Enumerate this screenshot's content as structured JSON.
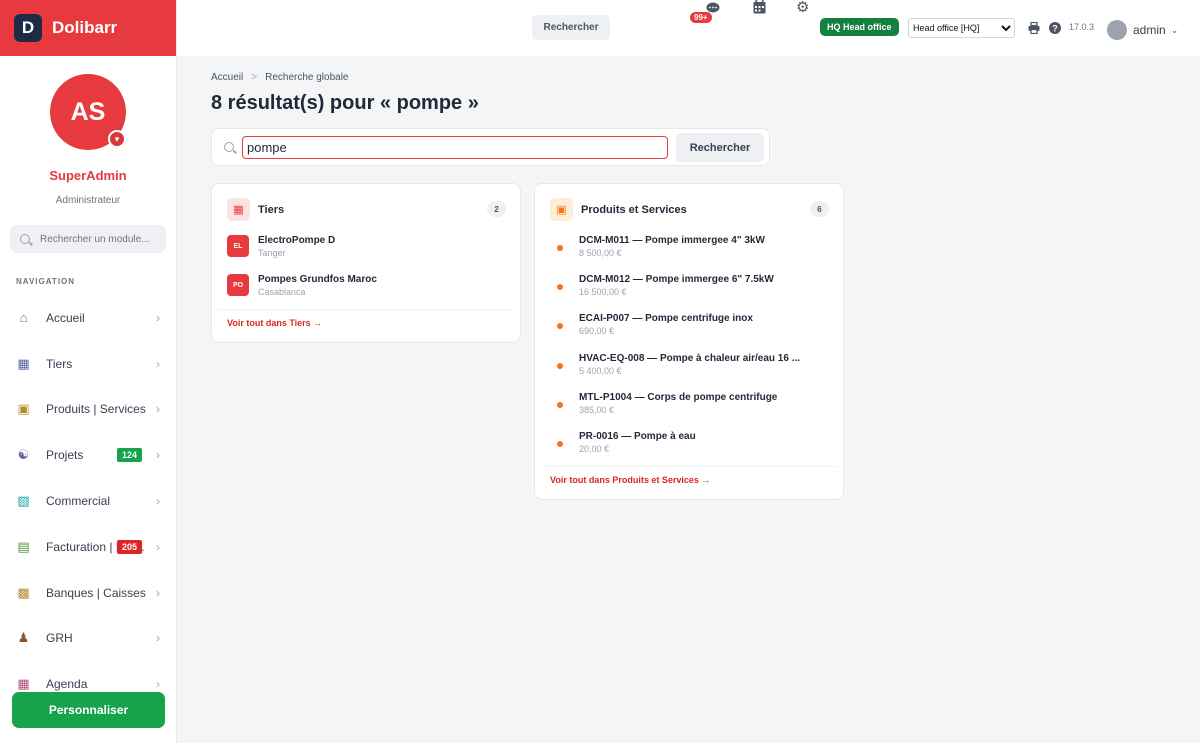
{
  "app": {
    "name": "Dolibarr",
    "logo_letter": "D"
  },
  "user": {
    "initials": "AS",
    "name": "SuperAdmin",
    "role": "Administrateur",
    "menu_label": "admin"
  },
  "sidebar": {
    "search_placeholder": "Rechercher un module...",
    "nav_title": "NAVIGATION",
    "items": [
      {
        "label": "Accueil",
        "icon": "home-icon"
      },
      {
        "label": "Tiers",
        "icon": "building-icon"
      },
      {
        "label": "Produits | Services",
        "icon": "box-icon"
      },
      {
        "label": "Projets",
        "icon": "project-icon",
        "badge": "124",
        "badge_color": "#16a34a"
      },
      {
        "label": "Commercial",
        "icon": "briefcase-icon"
      },
      {
        "label": "Facturation | Paiement",
        "icon": "invoice-icon",
        "badge": "205",
        "badge_color": "#dc2626"
      },
      {
        "label": "Banques | Caisses",
        "icon": "bank-icon"
      },
      {
        "label": "GRH",
        "icon": "user-tie-icon"
      },
      {
        "label": "Agenda",
        "icon": "calendar-icon"
      }
    ],
    "personalize_label": "Personnaliser"
  },
  "topbar": {
    "search_label": "Rechercher",
    "notification_count": "99+",
    "entity_badge": "HQ Head office",
    "entity_select_value": "Head office [HQ]",
    "version": "17.0.3"
  },
  "breadcrumb": {
    "home": "Accueil",
    "separator": ">",
    "current": "Recherche globale"
  },
  "page_title": "8 résultat(s) pour « pompe »",
  "search": {
    "value": "pompe",
    "button_label": "Rechercher"
  },
  "tiers_card": {
    "title": "Tiers",
    "count": "2",
    "items": [
      {
        "initials": "EL",
        "name": "ElectroPompe D",
        "city": "Tanger"
      },
      {
        "initials": "PO",
        "name": "Pompes Grundfos Maroc",
        "city": "Casablanca"
      }
    ],
    "link": "Voir tout dans Tiers →"
  },
  "products_card": {
    "title": "Produits et Services",
    "count": "6",
    "items": [
      {
        "name": "DCM-M011 — Pompe immergee 4\" 3kW",
        "price": "8 500,00 €"
      },
      {
        "name": "DCM-M012 — Pompe immergee 6\" 7.5kW",
        "price": "16 500,00 €"
      },
      {
        "name": "ECAI-P007 — Pompe centrifuge inox",
        "price": "690,00 €"
      },
      {
        "name": "HVAC-EQ-008 — Pompe à chaleur air/eau 16 ...",
        "price": "5 400,00 €"
      },
      {
        "name": "MTL-P1004 — Corps de pompe centrifuge",
        "price": "385,00 €"
      },
      {
        "name": "PR-0016 — Pompe à eau",
        "price": "20,00 €"
      }
    ],
    "link": "Voir tout dans Produits et Services →"
  },
  "colors": {
    "brand": "#e63a3f",
    "success": "#16a34a",
    "accent_orange": "#f97316"
  }
}
